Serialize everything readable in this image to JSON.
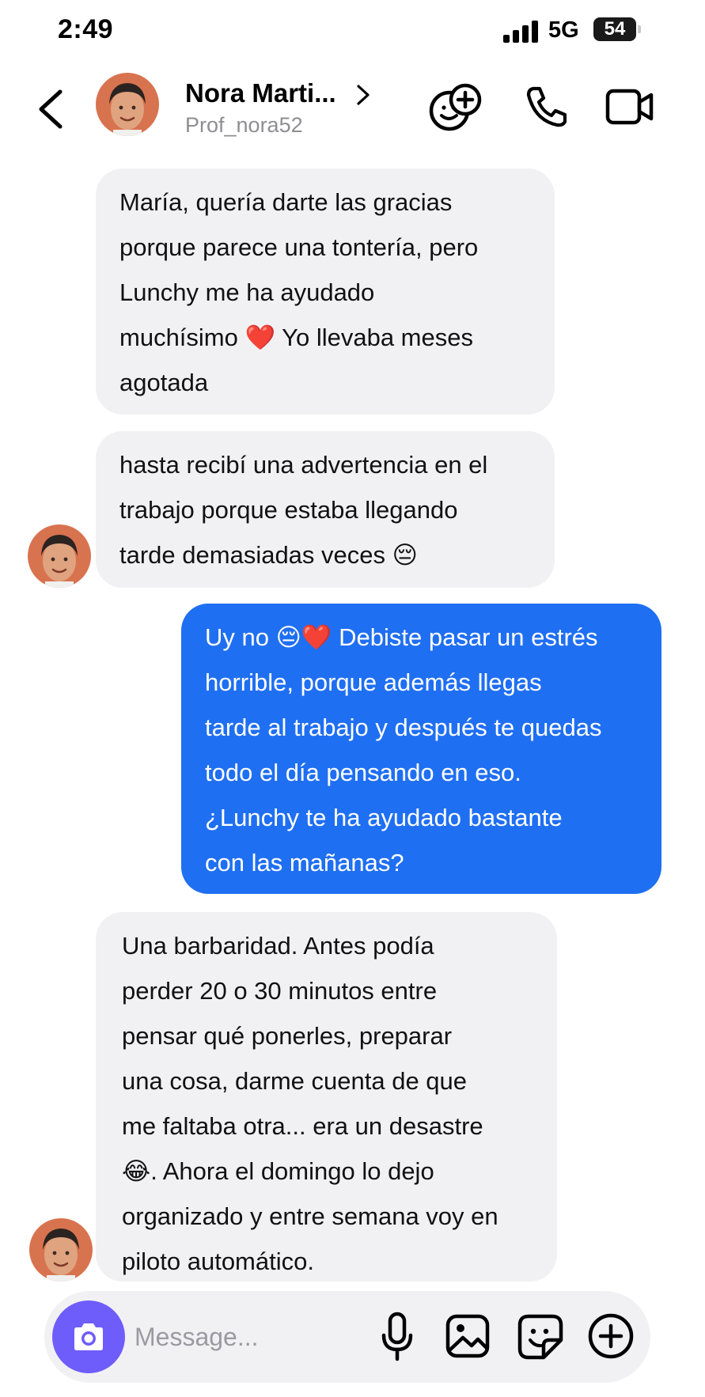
{
  "status_bar": {
    "time": "2:49",
    "network": "5G",
    "battery": "54"
  },
  "header": {
    "contact_name": "Nora Marti...",
    "handle": "Prof_nora52"
  },
  "messages": [
    {
      "direction": "incoming",
      "lines": [
        "María, quería darte las gracias",
        "porque parece una tontería, pero",
        "Lunchy me ha ayudado",
        "muchísimo ❤️ Yo llevaba meses",
        "agotada"
      ]
    },
    {
      "direction": "incoming",
      "lines": [
        "hasta recibí una advertencia en el",
        "trabajo porque estaba llegando",
        "tarde demasiadas veces 😔"
      ]
    },
    {
      "direction": "outgoing",
      "lines": [
        "Uy no 😔❤️ Debiste pasar un estrés",
        "horrible, porque además llegas",
        "tarde al trabajo y después te quedas",
        "todo el día pensando en eso.",
        "¿Lunchy te ha ayudado bastante",
        "con las mañanas?"
      ]
    },
    {
      "direction": "incoming",
      "lines": [
        "Una barbaridad. Antes podía",
        "perder 20 o 30 minutos entre",
        "pensar qué ponerles, preparar",
        "una cosa, darme cuenta de que",
        "me faltaba otra... era un desastre",
        "😂. Ahora el domingo lo dejo",
        "organizado y entre semana voy en",
        "piloto automático."
      ]
    }
  ],
  "composer": {
    "placeholder": "Message..."
  },
  "icons": {
    "back": "chevron-left-icon",
    "name_chevron": "chevron-right-icon",
    "add_person": "add-person-icon",
    "call": "phone-icon",
    "video": "video-camera-icon",
    "camera": "camera-icon",
    "mic": "microphone-icon",
    "gallery": "image-icon",
    "sticker": "sticker-icon",
    "more": "plus-circle-icon"
  },
  "colors": {
    "outgoing_bubble": "#1f6ff2",
    "incoming_bubble": "#f1f1f4",
    "camera_button": "#6e5dfb",
    "handle_text": "#8e8e93"
  }
}
